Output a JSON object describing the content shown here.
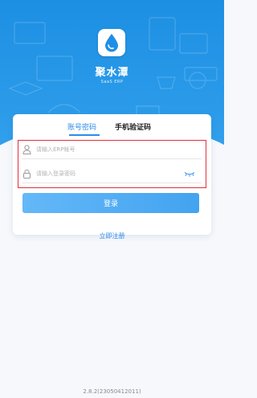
{
  "brand": {
    "name": "聚水潭",
    "subtitle": "SaaS ERP"
  },
  "tabs": [
    {
      "label": "账号密码",
      "active": true
    },
    {
      "label": "手机验证码",
      "active": false
    }
  ],
  "form": {
    "account_placeholder": "请输入ERP帐号",
    "password_placeholder": "请输入登录密码"
  },
  "login_button": "登录",
  "register_link": "立即注册",
  "version": "2.8.2(23050412011)",
  "colors": {
    "primary": "#2d8ceb",
    "hero": "#2b9be9",
    "button": "#52adf4",
    "highlight": "#e0303a"
  },
  "icons": [
    "drop-logo-icon",
    "user-icon",
    "lock-icon",
    "eye-closed-icon"
  ]
}
